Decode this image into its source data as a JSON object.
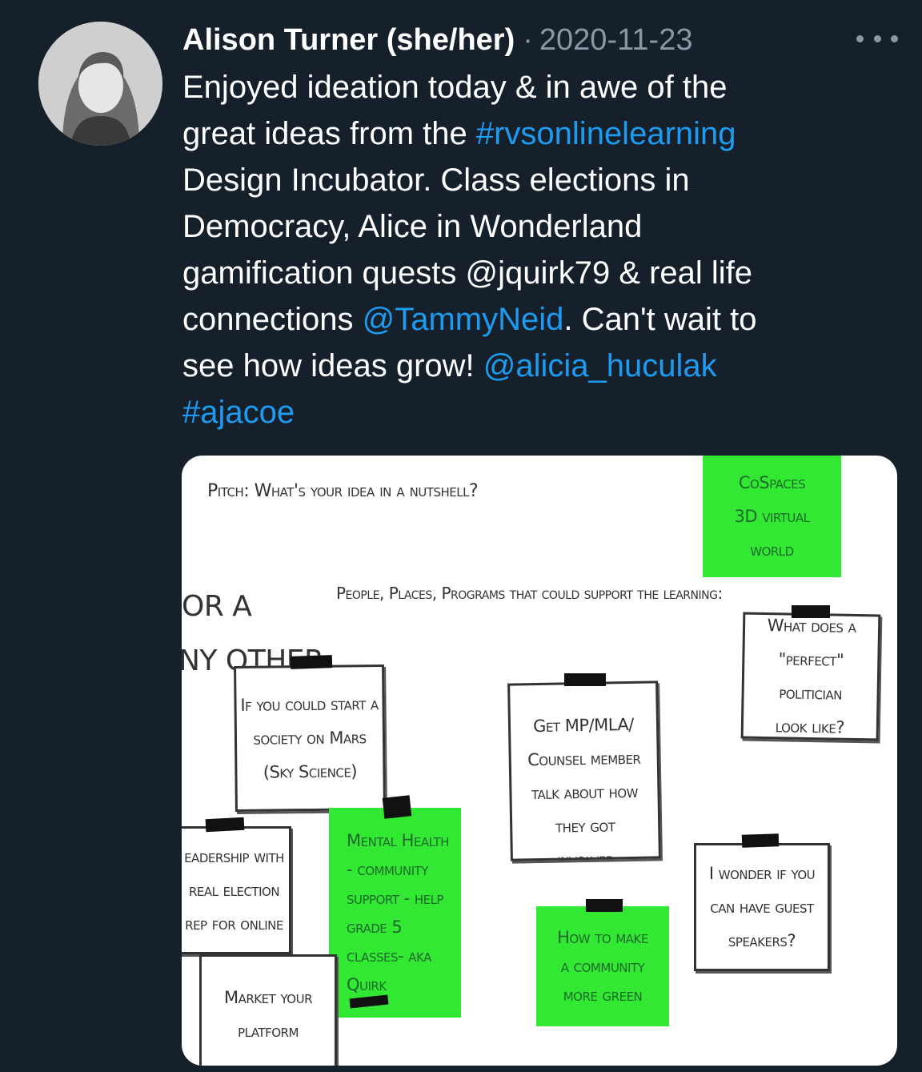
{
  "author": {
    "name": "Alison Turner (she/her)",
    "separator": "·",
    "date": "2020-11-23",
    "avatar_icon": "profile-photo"
  },
  "more_icon": "more-options-icon",
  "tweet": {
    "lines": [
      [
        {
          "text": "Enjoyed ideation today & in awe of the",
          "type": "plain"
        }
      ],
      [
        {
          "text": "great ideas from the ",
          "type": "plain"
        },
        {
          "text": "#rvsonlinelearning",
          "type": "hashtag"
        }
      ],
      [
        {
          "text": "Design Incubator. Class elections in",
          "type": "plain"
        }
      ],
      [
        {
          "text": "Democracy, Alice in Wonderland",
          "type": "plain"
        }
      ],
      [
        {
          "text": "gamification quests @jquirk79  & real life",
          "type": "plain"
        }
      ],
      [
        {
          "text": "connections ",
          "type": "plain"
        },
        {
          "text": "@TammyNeid",
          "type": "mention"
        },
        {
          "text": ". Can't wait to",
          "type": "plain"
        }
      ],
      [
        {
          "text": "see how ideas grow! ",
          "type": "plain"
        },
        {
          "text": "@alicia_huculak",
          "type": "mention"
        }
      ],
      [
        {
          "text": "#ajacoe",
          "type": "hashtag"
        }
      ]
    ]
  },
  "colors": {
    "background": "#15202b",
    "link": "#1d9bf0",
    "muted": "#8899a6",
    "sticky_green": "#33e833"
  },
  "media": {
    "pitch_label": "Pitch: What's your idea in a nutshell?",
    "people_label": "People, Places, Programs that could support the learning:",
    "edge_text_1": "OR A",
    "edge_text_2": "NY OTHER",
    "notes": {
      "cospaces": "CoSpaces\n3D virtual\nworld",
      "politician": "What does a\n\"perfect\" politician\nlook like?",
      "mars": "If you could start a\nsociety on Mars\n(Sky Science)",
      "mp": "Get MP/MLA/\nCounsel member\ntalk about how\nthey got\ninvolved",
      "leadership": "eadership with\nreal election\nrep for online",
      "mental": "Mental Health\n- community\nsupport - help\ngrade 5\nclasses- aka\nQuirk",
      "guest": "I wonder if you\ncan have guest\nspeakers?",
      "green": "How to make\na community\nmore green",
      "market": "Market your\nplatform"
    }
  }
}
